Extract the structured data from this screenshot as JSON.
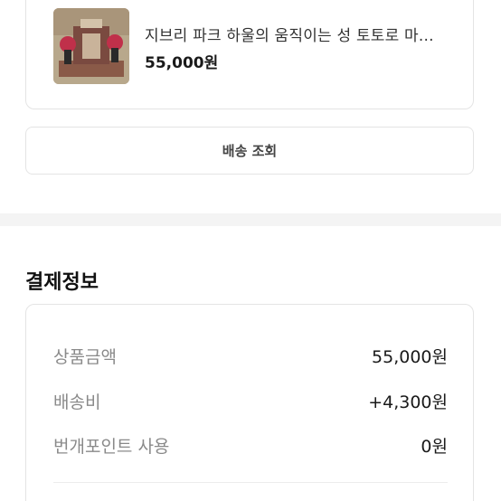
{
  "product": {
    "title": "지브리 파크 하울의 움직이는 성 토토로 마...",
    "price": "55,000원",
    "image": "product-thumbnail"
  },
  "shipping_button": {
    "label": "배송 조회"
  },
  "payment": {
    "section_title": "결제정보",
    "rows": [
      {
        "label": "상품금액",
        "value": "55,000원"
      },
      {
        "label": "배송비",
        "value": "+4,300원"
      },
      {
        "label": "번개포인트 사용",
        "value": "0원"
      }
    ]
  },
  "colors": {
    "border": "#e4e4e4",
    "label_gray": "#8a8a8a",
    "band": "#f4f4f4"
  }
}
